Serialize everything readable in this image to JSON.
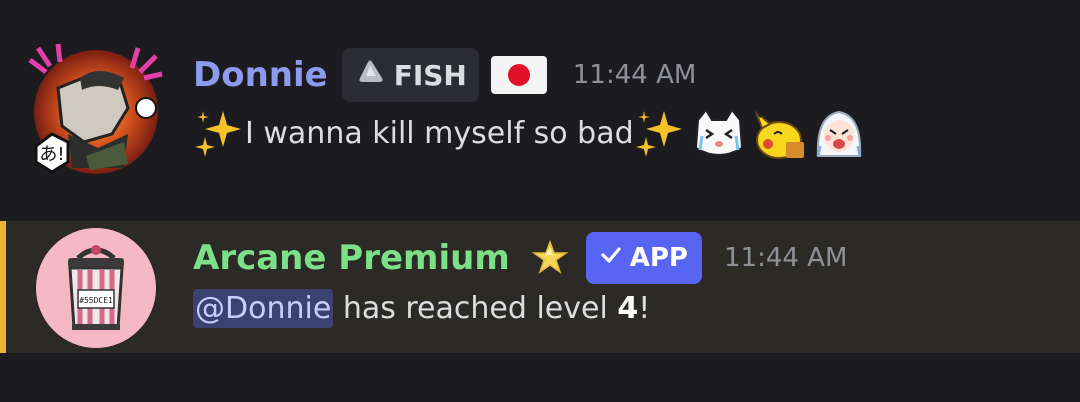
{
  "messages": [
    {
      "username": "Donnie",
      "username_color": "#8c9bf0",
      "tag": {
        "icon": "gray-gem-icon",
        "label": "FISH"
      },
      "flag": "japan-flag-icon",
      "timestamp": "11:44 AM",
      "text": "I wanna kill myself so bad",
      "emojis": [
        "sparkles-icon",
        "sparkles-icon",
        "crying-cat-sticker",
        "pikachu-sticker",
        "crying-girl-sticker"
      ]
    },
    {
      "username": "Arcane Premium",
      "username_color": "#7be087",
      "badge": {
        "icon": "star-icon"
      },
      "app_label": "APP",
      "timestamp": "11:44 AM",
      "mention": "@Donnie",
      "text_before_level": " has reached level ",
      "level": "4",
      "text_after_level": "!",
      "avatar_label": "#55DCE1",
      "highlight_color": "#f0b232"
    }
  ]
}
